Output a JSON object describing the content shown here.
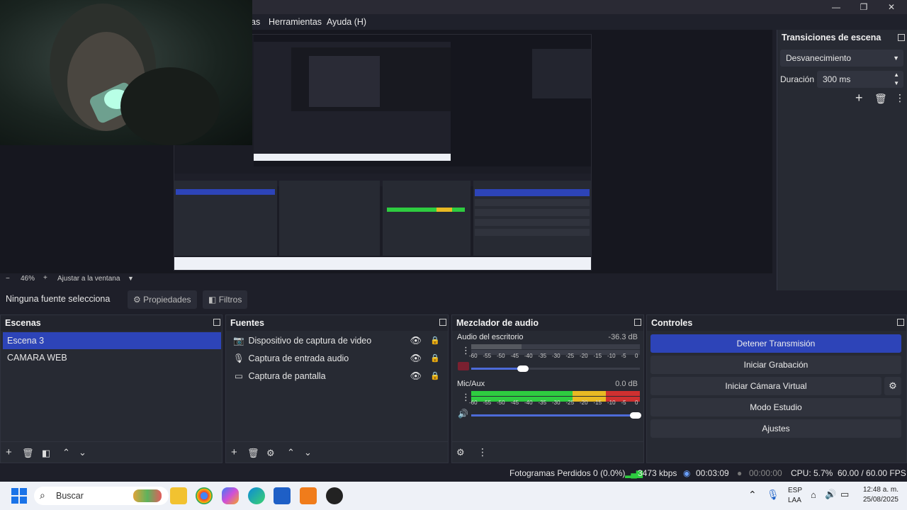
{
  "menu": {
    "items": [
      "as",
      "Herramientas",
      "Ayuda (H)"
    ]
  },
  "window_controls": {
    "minimize": "—",
    "maximize": "❐",
    "close": "✕"
  },
  "zoom": {
    "minus": "−",
    "level": "46%",
    "plus": "+",
    "fit": "Ajustar a la ventana"
  },
  "transitions": {
    "title": "Transiciones de escena",
    "type": "Desvanecimiento",
    "duration_label": "Duración",
    "duration_value": "300 ms"
  },
  "source_toolbar": {
    "no_source": "Ninguna fuente selecciona",
    "properties": "Propiedades",
    "filters": "Filtros"
  },
  "scenes": {
    "title": "Escenas",
    "items": [
      "Escena 3",
      "CAMARA WEB"
    ],
    "selected_index": 0
  },
  "sources": {
    "title": "Fuentes",
    "items": [
      {
        "label": "Dispositivo de captura de video",
        "icon": "camera-icon"
      },
      {
        "label": "Captura de entrada audio",
        "icon": "microphone-icon"
      },
      {
        "label": "Captura de pantalla",
        "icon": "monitor-icon"
      }
    ]
  },
  "mixer": {
    "title": "Mezclador de audio",
    "channels": [
      {
        "name": "Audio del escritorio",
        "db": "-36.3 dB",
        "level": 0.36,
        "fader": 0.33,
        "muted": true
      },
      {
        "name": "Mic/Aux",
        "db": "0.0 dB",
        "level": 1.0,
        "fader": 1.0,
        "muted": false
      }
    ],
    "scale": [
      "-60",
      "-55",
      "-50",
      "-45",
      "-40",
      "-35",
      "-30",
      "-25",
      "-20",
      "-15",
      "-10",
      "-5",
      "0"
    ]
  },
  "controls": {
    "title": "Controles",
    "stop_stream": "Detener Transmisión",
    "start_recording": "Iniciar Grabación",
    "virtual_camera": "Iniciar Cámara Virtual",
    "studio_mode": "Modo Estudio",
    "settings": "Ajustes"
  },
  "status": {
    "dropped": "Fotogramas Perdidos 0 (0.0%)",
    "bitrate": "3473 kbps",
    "stream_time": "00:03:09",
    "rec_time": "00:00:00",
    "cpu": "CPU: 5.7%",
    "fps": "60.00 / 60.00 FPS"
  },
  "taskbar": {
    "search": "Buscar",
    "lang_top": "ESP",
    "lang_bottom": "LAA",
    "time": "12:48 a. m.",
    "date": "25/08/2025"
  },
  "colors": {
    "accent": "#2d44b8",
    "meter_green": "#2ecc40",
    "meter_yellow": "#e8b923",
    "meter_red": "#d03030"
  }
}
